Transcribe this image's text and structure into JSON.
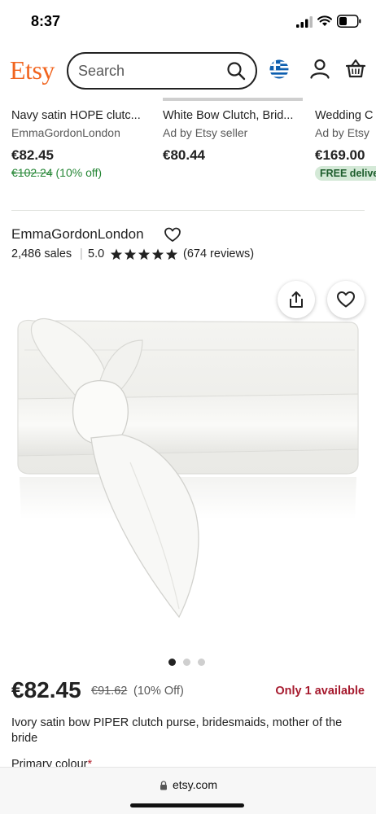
{
  "status_bar": {
    "time": "8:37"
  },
  "header": {
    "logo": "Etsy",
    "search": {
      "placeholder": "Search"
    }
  },
  "cards": [
    {
      "title": "Navy satin HOPE clutc...",
      "subtitle": "EmmaGordonLondon",
      "price": "€82.45",
      "old_price": "€102.24",
      "discount": "(10% off)"
    },
    {
      "title": "White Bow Clutch, Brid...",
      "subtitle": "Ad by Etsy seller",
      "price": "€80.44"
    },
    {
      "title": "Wedding C",
      "subtitle": "Ad by Etsy",
      "price": "€169.00",
      "badge": "FREE delive"
    }
  ],
  "shop": {
    "name": "EmmaGordonLondon",
    "sales": "2,486 sales",
    "separator": "|",
    "rating": "5.0",
    "stars": 5,
    "reviews": "(674 reviews)"
  },
  "gallery": {
    "image_count": 3,
    "active_index": 0
  },
  "product": {
    "price": "€82.45",
    "old_price": "€91.62",
    "discount": "(10% Off)",
    "availability": "Only 1 available",
    "title": "Ivory satin bow PIPER clutch purse, bridesmaids, mother of the bride",
    "primary_colour_label": "Primary colour",
    "required_mark": "*"
  },
  "browser": {
    "url": "etsy.com"
  },
  "colors": {
    "brand": "#f1641e",
    "sale_green": "#258635",
    "alert_red": "#a61a2e",
    "badge_bg": "#d4e9d7"
  }
}
